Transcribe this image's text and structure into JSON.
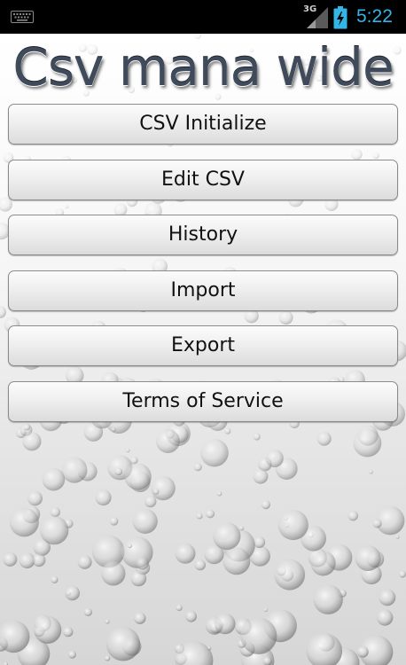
{
  "status_bar": {
    "network_type": "3G",
    "time": "5:22",
    "icons": [
      "keyboard-icon",
      "signal-icon",
      "battery-charging-icon"
    ],
    "accent_color": "#33b5e5"
  },
  "app": {
    "title": "Csv mana wide"
  },
  "menu": {
    "buttons": [
      {
        "label": "CSV Initialize"
      },
      {
        "label": "Edit CSV"
      },
      {
        "label": "History"
      },
      {
        "label": "Import"
      },
      {
        "label": "Export"
      },
      {
        "label": "Terms of Service"
      }
    ]
  }
}
